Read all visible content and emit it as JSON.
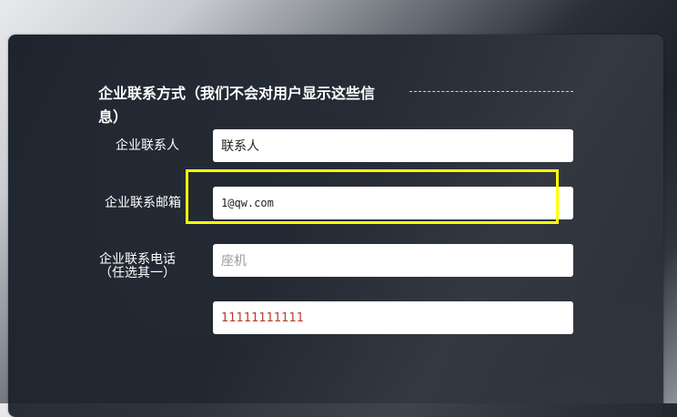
{
  "section": {
    "title": "企业联系方式（我们不会对用户显示这些信息）"
  },
  "fields": {
    "contact_person": {
      "label": "企业联系人",
      "value": "联系人"
    },
    "email": {
      "label": "企业联系邮箱",
      "value": "1@qw.com"
    },
    "phone": {
      "label_line1": "企业联系电话",
      "label_line2": "（任选其一）",
      "placeholder": "座机"
    },
    "mobile": {
      "value": "11111111111"
    }
  },
  "colors": {
    "highlight": "#ffff00",
    "mobile_text": "#c0392b"
  }
}
